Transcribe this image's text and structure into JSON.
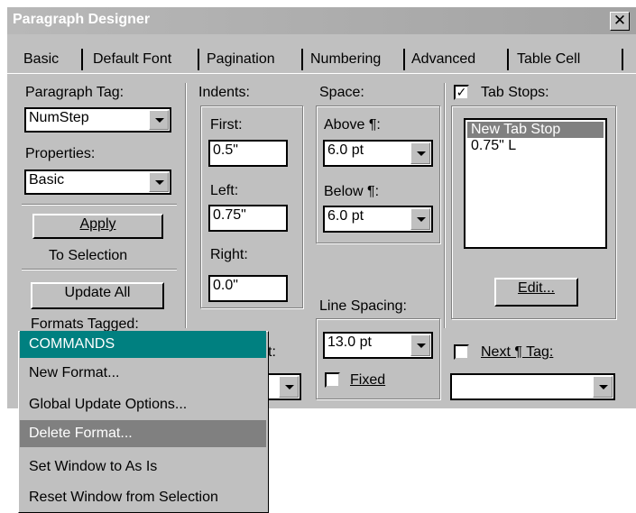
{
  "window": {
    "title": "Paragraph Designer",
    "close_glyph": "✕"
  },
  "tabs": [
    "Basic",
    "Default Font",
    "Pagination",
    "Numbering",
    "Advanced",
    "Table Cell"
  ],
  "left": {
    "paragraph_tag_label": "Paragraph Tag:",
    "paragraph_tag_value": "NumStep",
    "properties_label": "Properties:",
    "properties_value": "Basic",
    "apply_label": "Apply",
    "to_selection_label": "To Selection",
    "update_all_label": "Update All",
    "formats_tagged_label": "Formats Tagged:"
  },
  "indents": {
    "label": "Indents:",
    "first_label": "First:",
    "first_value": "0.5\"",
    "left_label": "Left:",
    "left_value": "0.75\"",
    "right_label": "Right:",
    "right_value": "0.0\""
  },
  "space": {
    "label": "Space:",
    "above_label": "Above ¶:",
    "above_value": "6.0 pt",
    "below_label": "Below ¶:",
    "below_value": "6.0 pt",
    "line_spacing_label": "Line Spacing:",
    "line_spacing_value": "13.0 pt",
    "fixed_label": "Fixed",
    "fixed_checked": false
  },
  "tab_stops": {
    "label": "Tab Stops:",
    "checked": true,
    "check_glyph": "✓",
    "items": [
      "New Tab Stop",
      "0.75\"  L"
    ],
    "edit_label": "Edit...",
    "next_tag_label": "Next ¶ Tag:",
    "next_tag_checked": false
  },
  "partial_label": "t:",
  "commands_menu": {
    "items": [
      "COMMANDS",
      "New Format...",
      "Global Update Options...",
      "Delete Format...",
      "Set Window to As Is",
      "Reset Window from Selection"
    ]
  }
}
